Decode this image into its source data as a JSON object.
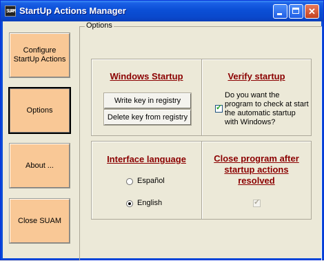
{
  "window": {
    "title": "StartUp Actions Manager",
    "icon_text": "SUAM",
    "controls": {
      "minimize": "minimize-icon",
      "maximize": "maximize-icon",
      "close": "close-icon",
      "close_glyph": "✕"
    }
  },
  "nav": {
    "configure": "Configure StartUp Actions",
    "options": "Options",
    "about": "About ...",
    "close": "Close SUAM"
  },
  "options": {
    "legend": "Options",
    "windows_startup": {
      "title": "Windows Startup",
      "write_key": "Write key in registry",
      "delete_key": "Delete key from registry"
    },
    "verify_startup": {
      "title": "Verify startup",
      "question": "Do you want the program to check at start the automatic startup with Windows?",
      "checked": true,
      "check_glyph": "✓"
    },
    "interface_language": {
      "title": "Interface language",
      "options": [
        "Español",
        "English"
      ],
      "selected": "English"
    },
    "close_after": {
      "title": "Close program after startup actions resolved",
      "checked": true,
      "enabled": false,
      "check_glyph": "✓"
    }
  },
  "colors": {
    "title_text": "#8b0000",
    "nav_button": "#f9c896",
    "titlebar": "#0b4fd6",
    "check": "#21a121"
  }
}
